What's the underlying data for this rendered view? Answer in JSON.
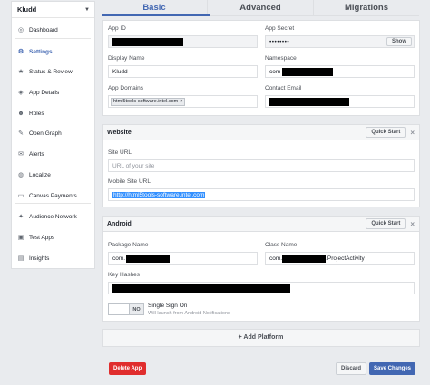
{
  "sidebar": {
    "app_name": "Kludd",
    "items": [
      {
        "label": "Dashboard",
        "icon": "dashboard-icon",
        "glyph": "◎"
      },
      {
        "label": "Settings",
        "icon": "gear-icon",
        "glyph": "⚙"
      },
      {
        "label": "Status & Review",
        "icon": "star-icon",
        "glyph": "★"
      },
      {
        "label": "App Details",
        "icon": "cube-icon",
        "glyph": "◈"
      },
      {
        "label": "Roles",
        "icon": "people-icon",
        "glyph": "☻"
      },
      {
        "label": "Open Graph",
        "icon": "graph-icon",
        "glyph": "✎"
      },
      {
        "label": "Alerts",
        "icon": "bell-icon",
        "glyph": "✉"
      },
      {
        "label": "Localize",
        "icon": "globe-icon",
        "glyph": "◍"
      },
      {
        "label": "Canvas Payments",
        "icon": "card-icon",
        "glyph": "▭"
      },
      {
        "label": "Audience Network",
        "icon": "network-icon",
        "glyph": "✦"
      },
      {
        "label": "Test Apps",
        "icon": "flask-icon",
        "glyph": "▣"
      },
      {
        "label": "Insights",
        "icon": "chart-icon",
        "glyph": "▤"
      }
    ]
  },
  "tabs": [
    "Basic",
    "Advanced",
    "Migrations"
  ],
  "basic": {
    "app_id_label": "App ID",
    "app_secret_label": "App Secret",
    "app_secret_value": "••••••••",
    "show_label": "Show",
    "display_name_label": "Display Name",
    "display_name_value": "Kludd",
    "namespace_label": "Namespace",
    "namespace_prefix": "com-",
    "app_domains_label": "App Domains",
    "app_domain_chip": "html5tools-software.intel.com",
    "contact_email_label": "Contact Email"
  },
  "website": {
    "title": "Website",
    "quick_start": "Quick Start",
    "site_url_label": "Site URL",
    "site_url_placeholder": "URL of your site",
    "mobile_site_url_label": "Mobile Site URL",
    "mobile_site_url_value": "http://html5tools-software.intel.com"
  },
  "android": {
    "title": "Android",
    "quick_start": "Quick Start",
    "package_name_label": "Package Name",
    "package_prefix": "com.",
    "class_name_label": "Class Name",
    "class_prefix": "com.",
    "class_suffix": ".ProjectActivity",
    "key_hashes_label": "Key Hashes",
    "sso_label": "Single Sign On",
    "sso_help": "Will launch from Android Notifications",
    "toggle_state": "NO"
  },
  "add_platform": "+ Add Platform",
  "footer": {
    "delete": "Delete App",
    "discard": "Discard",
    "save": "Save Changes"
  },
  "colors": {
    "accent": "#4267b2",
    "danger": "#e02d2d",
    "selection": "#3390ff"
  }
}
